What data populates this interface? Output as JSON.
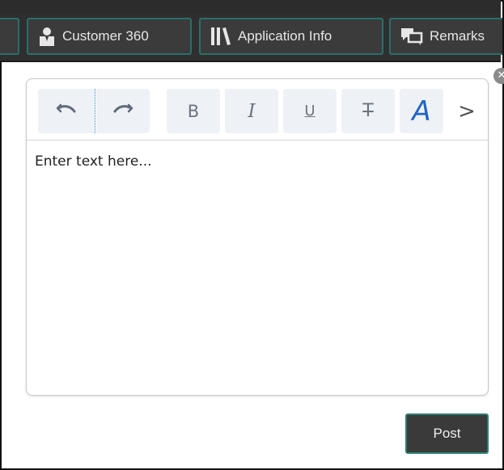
{
  "tabs": {
    "customer360": {
      "label": "Customer 360",
      "icon": "user-icon"
    },
    "application_info": {
      "label": "Application Info",
      "icon": "library-books-icon"
    },
    "remarks": {
      "label": "Remarks",
      "icon": "comments-icon"
    }
  },
  "dialog": {
    "close_icon": "close-icon"
  },
  "toolbar": {
    "undo_icon": "undo-icon",
    "redo_icon": "redo-icon",
    "bold_label": "B",
    "italic_label": "I",
    "underline_label": "U",
    "strikethrough_label": "T",
    "font_label": "A",
    "more_label": ">"
  },
  "editor": {
    "placeholder": "Enter text here..."
  },
  "actions": {
    "post_label": "Post"
  },
  "colors": {
    "tab_background": "#3b3b3b",
    "tab_border": "#2a6f6a",
    "toolbar_button_bg": "#eef1f5",
    "font_accent": "#1e66c2",
    "post_border": "#2a7f72"
  }
}
